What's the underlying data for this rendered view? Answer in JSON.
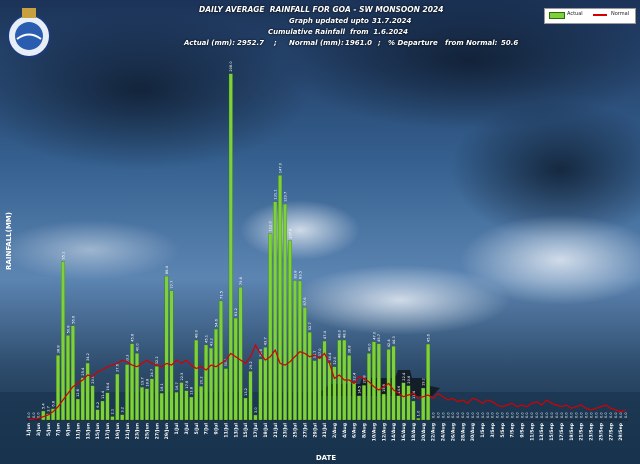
{
  "header": {
    "title": "DAILY AVERAGE  RAINFALL FOR GOA - SW MONSOON 2024",
    "updated_label": "Graph updated upto",
    "updated_date": "31.7.2024",
    "cumulative_label": "Cumulative Rainfall  from  1.6.2024",
    "actual_label": "Actual (mm):",
    "actual_value": "2952.7",
    "normal_label": "Normal (mm):",
    "normal_value": "1961.0",
    "departure_label": "% Departure   from Normal:",
    "departure_value": "50.6"
  },
  "colors": {
    "actual": "#7fd13a",
    "normal": "#d40000",
    "sky_top": "#2a4a7a",
    "sea": "#1a3550"
  },
  "chart_data": {
    "type": "bar",
    "xlabel": "DATE",
    "ylabel": "RAINFALL(MM)",
    "ylim": [
      0,
      215
    ],
    "legend": [
      "Actual",
      "Normal"
    ],
    "legend_position": "top-right",
    "tick_labels": [
      "1/Jun",
      "3/Jun",
      "5/Jun",
      "7/Jun",
      "9/Jun",
      "11/Jun",
      "13/Jun",
      "15/Jun",
      "17/Jun",
      "19/Jun",
      "21/Jun",
      "23/Jun",
      "25/Jun",
      "27/Jun",
      "29/Jun",
      "1/Jul",
      "3/Jul",
      "5/Jul",
      "7/Jul",
      "9/Jul",
      "11/Jul",
      "13/Jul",
      "15/Jul",
      "17/Jul",
      "19/Jul",
      "21/Jul",
      "23/Jul",
      "25/Jul",
      "27/Jul",
      "29/Jul",
      "31/Jul",
      "2/Aug",
      "4/Aug",
      "6/Aug",
      "8/Aug",
      "10/Aug",
      "12/Aug",
      "14/Aug",
      "16/Aug",
      "18/Aug",
      "20/Aug",
      "22/Aug",
      "24/Aug",
      "26/Aug",
      "28/Aug",
      "30/Aug",
      "1/Sep",
      "3/Sep",
      "5/Sep",
      "7/Sep",
      "9/Sep",
      "11/Sep",
      "13/Sep",
      "15/Sep",
      "17/Sep",
      "19/Sep",
      "21/Sep",
      "23/Sep",
      "25/Sep",
      "27/Sep",
      "29/Sep"
    ],
    "series": [
      {
        "name": "Actual",
        "values": [
          0.0,
          0.0,
          0.0,
          5.4,
          3.7,
          6.8,
          38.8,
          95.1,
          50.8,
          56.6,
          12.6,
          25.4,
          34.2,
          20.6,
          6.2,
          11.4,
          16.4,
          2.1,
          27.6,
          3.2,
          33.3,
          45.8,
          40.0,
          19.7,
          18.8,
          24.7,
          32.2,
          16.1,
          86.4,
          77.7,
          16.7,
          22.5,
          17.6,
          13.8,
          48.0,
          20.2,
          45.1,
          43.2,
          54.6,
          71.5,
          30.9,
          208.0,
          61.2,
          79.8,
          13.2,
          29.2,
          3.0,
          36.6,
          43.7,
          112.0,
          131.1,
          147.0,
          129.7,
          107.6,
          83.8,
          83.5,
          67.6,
          52.7,
          35.7,
          37.0,
          47.4,
          34.4,
          32.0,
          48.0,
          48.0,
          38.8,
          22.4,
          14.5,
          20.8,
          40.0,
          47.0,
          45.7,
          15.6,
          42.4,
          44.3,
          14.6,
          22.4,
          20.6,
          11.4,
          1.0,
          19.2,
          45.6
        ]
      },
      {
        "name": "Normal",
        "values": [
          0.2,
          0.5,
          1.0,
          2.0,
          3.0,
          5.0,
          8.0,
          12.0,
          16.0,
          20.0,
          22.0,
          24.0,
          27.0,
          26.0,
          29.0,
          30.0,
          32.0,
          33.0,
          34.0,
          36.0,
          35.0,
          33.0,
          32.0,
          34.0,
          36.0,
          34.0,
          33.0,
          32.0,
          34.0,
          33.0,
          36.0,
          34.0,
          36.0,
          33.0,
          31.0,
          32.0,
          30.0,
          33.0,
          32.0,
          34.0,
          36.0,
          40.0,
          38.0,
          36.0,
          34.0,
          38.0,
          45.0,
          40.0,
          36.0,
          38.0,
          42.0,
          34.0,
          33.0,
          35.0,
          38.0,
          41.0,
          40.0,
          38.0,
          39.0,
          37.0,
          40.0,
          34.0,
          25.0,
          27.0,
          24.0,
          24.0,
          22.0,
          26.0,
          25.0,
          23.0,
          20.0,
          18.0,
          20.0,
          22.0,
          18.0,
          16.0,
          14.0,
          15.0,
          16.0,
          13.0,
          14.0,
          15.0,
          13.0,
          16.0,
          14.0,
          12.0,
          13.0,
          11.0,
          12.0,
          10.0,
          13.0,
          12.0,
          10.0,
          12.0,
          11.0,
          9.0,
          8.0,
          9.0,
          10.0,
          8.0,
          9.0,
          8.0,
          10.0,
          11.0,
          9.0,
          12.0,
          10.0,
          9.0,
          8.0,
          9.0,
          7.0,
          8.0,
          9.0,
          7.0,
          6.0,
          7.0,
          8.0,
          9.0,
          7.0,
          6.0,
          5.0,
          6.0
        ]
      }
    ]
  }
}
